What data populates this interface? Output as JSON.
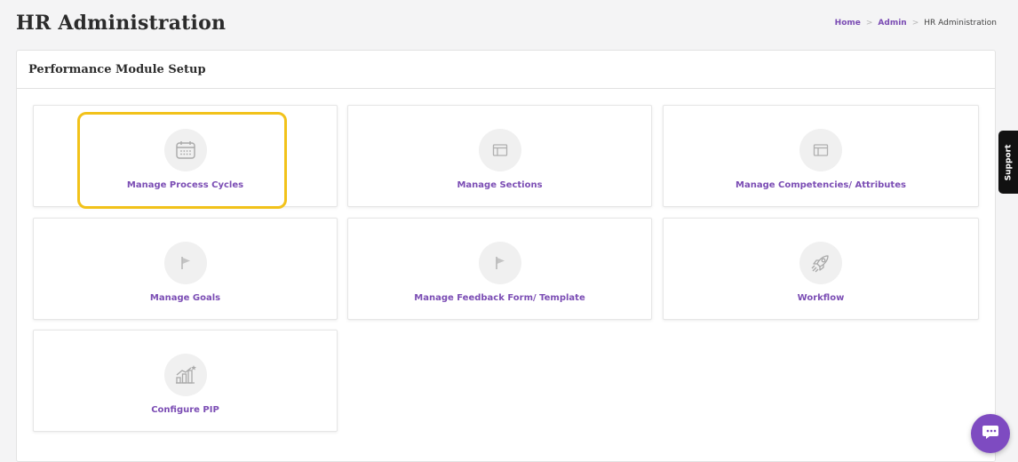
{
  "header": {
    "title": "HR Administration"
  },
  "breadcrumb": {
    "items": [
      "Home",
      "Admin"
    ],
    "current": "HR Administration"
  },
  "panel": {
    "title": "Performance Module Setup"
  },
  "cards": [
    {
      "label": "Manage Process Cycles",
      "icon": "calendar-icon",
      "highlighted": true
    },
    {
      "label": "Manage Sections",
      "icon": "layout-icon"
    },
    {
      "label": "Manage Competencies/ Attributes",
      "icon": "layout-icon"
    },
    {
      "label": "Manage Goals",
      "icon": "flag-icon"
    },
    {
      "label": "Manage Feedback Form/ Template",
      "icon": "flag-icon"
    },
    {
      "label": "Workflow",
      "icon": "rocket-icon"
    },
    {
      "label": "Configure PIP",
      "icon": "growth-chart-icon"
    }
  ],
  "support_tab": {
    "label": "Support"
  },
  "chat_button": {
    "icon": "chat-icon"
  },
  "colors": {
    "accent": "#7b4db4",
    "highlight": "#f2c21a",
    "icon_bg": "#f0f0f0",
    "icon_stroke": "#b0b0b0"
  }
}
